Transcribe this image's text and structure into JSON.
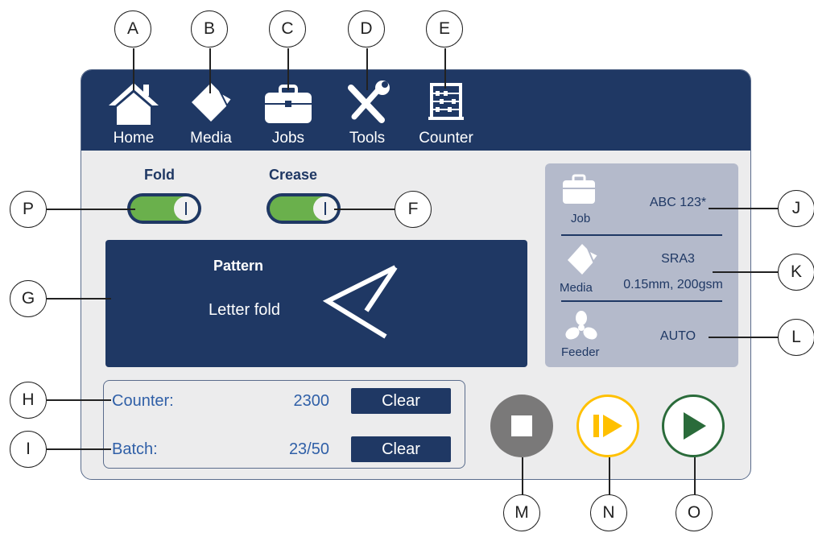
{
  "callouts": {
    "a": "A",
    "b": "B",
    "c": "C",
    "d": "D",
    "e": "E",
    "f": "F",
    "g": "G",
    "h": "H",
    "i": "I",
    "j": "J",
    "k": "K",
    "l": "L",
    "m": "M",
    "n": "N",
    "o": "O",
    "p": "P"
  },
  "nav": {
    "home": "Home",
    "media": "Media",
    "jobs": "Jobs",
    "tools": "Tools",
    "counter": "Counter"
  },
  "toggles": {
    "fold": {
      "label": "Fold",
      "state": "on"
    },
    "crease": {
      "label": "Crease",
      "state": "on"
    }
  },
  "pattern": {
    "title": "Pattern",
    "name": "Letter fold"
  },
  "info": {
    "job_label": "Job",
    "job_value": "ABC 123*",
    "media_label": "Media",
    "media_size": "SRA3",
    "media_spec": "0.15mm, 200gsm",
    "feeder_label": "Feeder",
    "feeder_value": "AUTO"
  },
  "counters": {
    "counter_label": "Counter:",
    "counter_value": "2300",
    "batch_label": "Batch:",
    "batch_value": "23/50",
    "clear_label": "Clear"
  },
  "colors": {
    "navy": "#1f3864",
    "toggle_green": "#6ab04c",
    "stop_gray": "#7a7979",
    "step_yellow": "#ffc000",
    "run_green": "#2a6b3a"
  },
  "icons": {
    "home": "home-icon",
    "media": "media-icon",
    "jobs": "briefcase-icon",
    "tools": "tools-icon",
    "counter": "abacus-icon",
    "feeder": "fan-icon",
    "stop": "stop-icon",
    "step": "step-play-icon",
    "run": "play-icon"
  }
}
